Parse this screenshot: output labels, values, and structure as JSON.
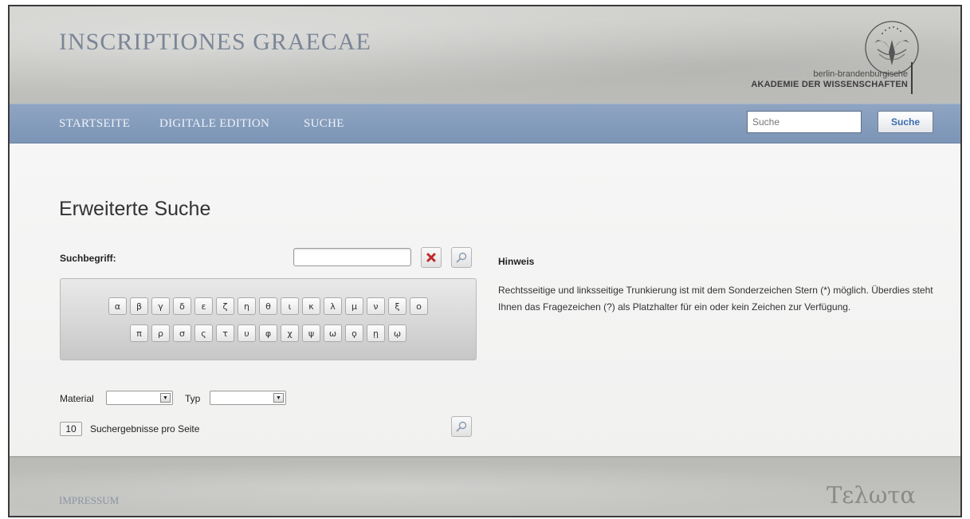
{
  "header": {
    "title": "INSCRIPTIONES GRAECAE",
    "academy_line1": "berlin-brandenburgische",
    "academy_line2": "AKADEMIE DER WISSENSCHAFTEN"
  },
  "nav": {
    "items": [
      {
        "label": "STARTSEITE"
      },
      {
        "label": "DIGITALE EDITION"
      },
      {
        "label": "SUCHE"
      }
    ],
    "search_placeholder": "Suche",
    "search_button": "Suche"
  },
  "main": {
    "heading": "Erweiterte Suche",
    "search_term_label": "Suchbegriff:",
    "search_term_value": "",
    "keyboard": {
      "row1": [
        "α",
        "β",
        "γ",
        "δ",
        "ε",
        "ζ",
        "η",
        "θ",
        "ι",
        "κ",
        "λ",
        "μ",
        "ν",
        "ξ",
        "ο"
      ],
      "row2": [
        "π",
        "ρ",
        "σ",
        "ς",
        "τ",
        "υ",
        "φ",
        "χ",
        "ψ",
        "ω",
        "ϙ",
        "ῃ",
        "ῳ"
      ]
    },
    "material_label": "Material",
    "material_value": "",
    "type_label": "Typ",
    "type_value": "",
    "per_page_value": "10",
    "per_page_label": "Suchergebnisse pro Seite",
    "hint_heading": "Hinweis",
    "hint_text": "Rechtsseitige und linksseitige Trunkierung ist mit dem Sonderzeichen Stern (*) möglich. Überdies steht Ihnen das Fragezeichen (?) als Platzhalter für ein oder kein Zeichen zur Verfügung."
  },
  "footer": {
    "link": "IMPRESSUM",
    "logo": "Τελωτα"
  },
  "colors": {
    "navbar": "#7f97b8",
    "title": "#7b8697",
    "clear_icon": "#c0272d",
    "search_button_text": "#3a6bb0"
  },
  "icons": {
    "clear": "close-icon",
    "search": "magnifier-icon",
    "emblem": "eagle-emblem-icon"
  }
}
